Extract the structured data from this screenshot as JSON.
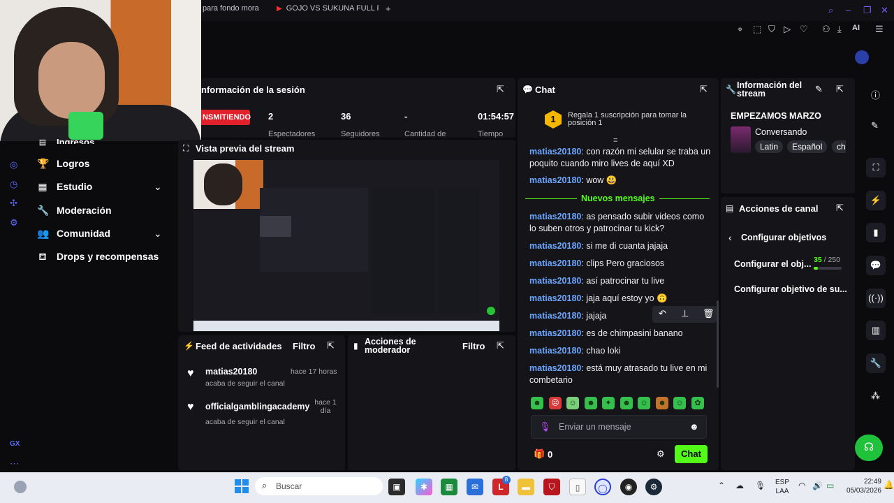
{
  "browser": {
    "tabs": [
      {
        "label": "para fondo mora"
      },
      {
        "label": "GOJO VS SUKUNA FULL F"
      }
    ],
    "new_tab": "+",
    "extension_label": "AI"
  },
  "session": {
    "title": "nformación de la sesión",
    "live_badge": "NSMITIENDO",
    "stats": [
      {
        "value": "2",
        "label": "Espectadores"
      },
      {
        "value": "36",
        "label": "Seguidores"
      },
      {
        "value": "-",
        "label": "Cantidad de"
      },
      {
        "value": "01:54:57",
        "label": "Tiempo"
      }
    ]
  },
  "sidebar": {
    "partial_item": "Ingresos",
    "items": [
      {
        "label": "Logros",
        "icon": "trophy-icon",
        "expandable": false
      },
      {
        "label": "Estudio",
        "icon": "studio-icon",
        "expandable": true
      },
      {
        "label": "Moderación",
        "icon": "wrench-icon",
        "expandable": false
      },
      {
        "label": "Comunidad",
        "icon": "community-icon",
        "expandable": true
      },
      {
        "label": "Drops y recompensas",
        "icon": "drops-icon",
        "expandable": false
      }
    ],
    "footer": "GX"
  },
  "preview": {
    "title": "Vista previa del stream"
  },
  "activity": {
    "title": "Feed de actividades",
    "filter": "Filtro",
    "items": [
      {
        "user": "matias20180",
        "time": "hace 17 horas",
        "desc": "acaba de seguir el canal"
      },
      {
        "user": "officialgamblingacademy",
        "time": "hace 1 día",
        "desc": "acaba de seguir el canal"
      }
    ]
  },
  "mod_actions": {
    "title": "Acciones de moderador",
    "filter": "Filtro"
  },
  "chat": {
    "title": "Chat",
    "sub_goal": "Regala 1 suscripción para tomar la posición 1",
    "rank": "1",
    "new_messages": "Nuevos mensajes",
    "messages_before": [
      {
        "user": "matias20180",
        "text": ": con razón mi selular se traba un poquito cuando miro lives de aquí XD"
      },
      {
        "user": "matias20180",
        "text": ": wow 😃"
      }
    ],
    "messages_after": [
      {
        "user": "matias20180",
        "text": ": as pensado subir videos como lo suben otros y patrocinar tu kick?"
      },
      {
        "user": "matias20180",
        "text": ": si me di cuanta jajaja"
      },
      {
        "user": "matias20180",
        "text": ": clips Pero graciosos"
      },
      {
        "user": "matias20180",
        "text": ": así patrocinar tu live"
      },
      {
        "user": "matias20180",
        "text": ": jaja aquí estoy yo 🙃"
      },
      {
        "user": "matias20180",
        "text": ": jajaja"
      },
      {
        "user": "matias20180",
        "text": ": es de chimpasini banano"
      },
      {
        "user": "matias20180",
        "text": ": chao loki"
      },
      {
        "user": "matias20180",
        "text": ": está muy atrasado tu live en mi combetario"
      }
    ],
    "input_placeholder": "Enviar un mensaje",
    "points": "0",
    "send_label": "Chat",
    "accent": "#53fc18"
  },
  "stream_info": {
    "title": "Información del stream",
    "stream_title": "EMPEZAMOS MARZO",
    "category": "Conversando",
    "tags": [
      "Latin",
      "Español",
      "ch"
    ]
  },
  "channel_actions": {
    "title": "Acciones de canal",
    "back_label": "Configurar objetivos",
    "goal_label": "Configurar el obj...",
    "goal_current": "35",
    "goal_total": "/ 250",
    "goal_progress": 0.14,
    "sub_goal_label": "Configurar objetivo de su..."
  },
  "taskbar": {
    "search": "Buscar",
    "lang1": "ESP",
    "lang2": "LAA",
    "time": "22:49",
    "date": "05/03/2026",
    "badge": "8"
  }
}
